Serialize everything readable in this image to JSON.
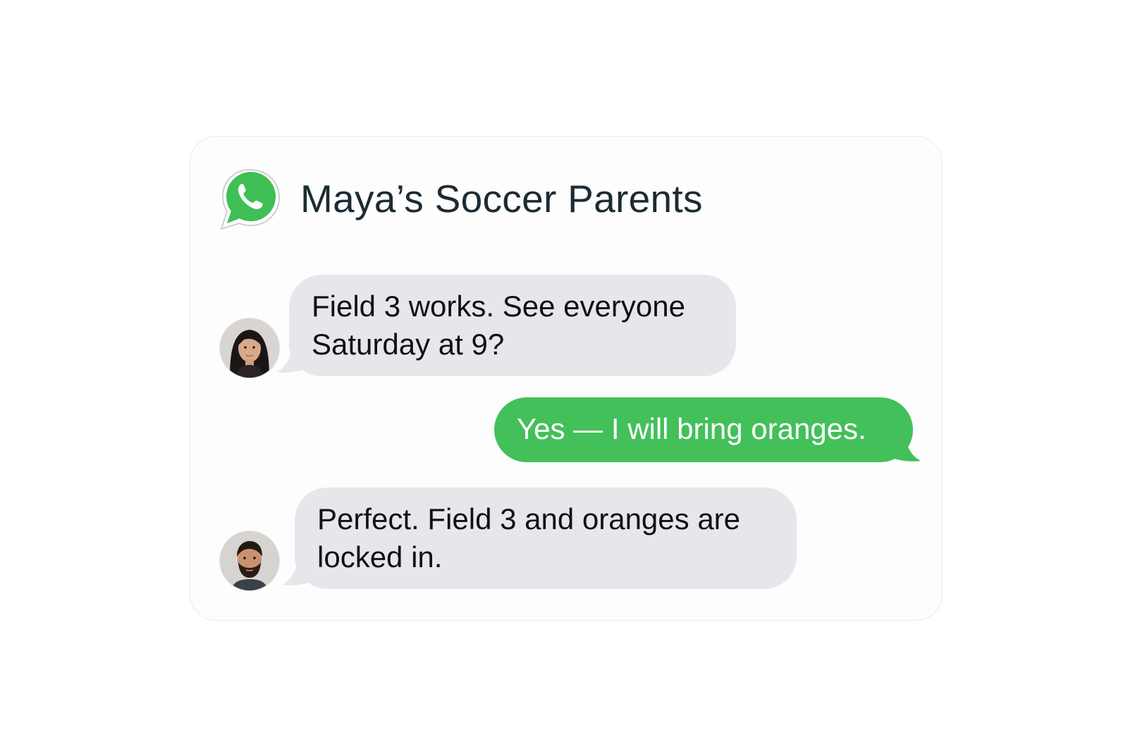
{
  "chat": {
    "title": "Maya’s Soccer Parents",
    "app_icon": "whatsapp-icon",
    "accent_color": "#43c05a",
    "incoming_bubble_color": "#e7e6eb"
  },
  "messages": [
    {
      "direction": "incoming",
      "avatar": "woman-avatar",
      "text": "Field 3 works. See everyone\nSaturday at 9?"
    },
    {
      "direction": "outgoing",
      "text": "Yes — I will bring oranges."
    },
    {
      "direction": "incoming",
      "avatar": "man-avatar",
      "text": "Perfect. Field 3 and oranges are\nlocked in."
    }
  ]
}
